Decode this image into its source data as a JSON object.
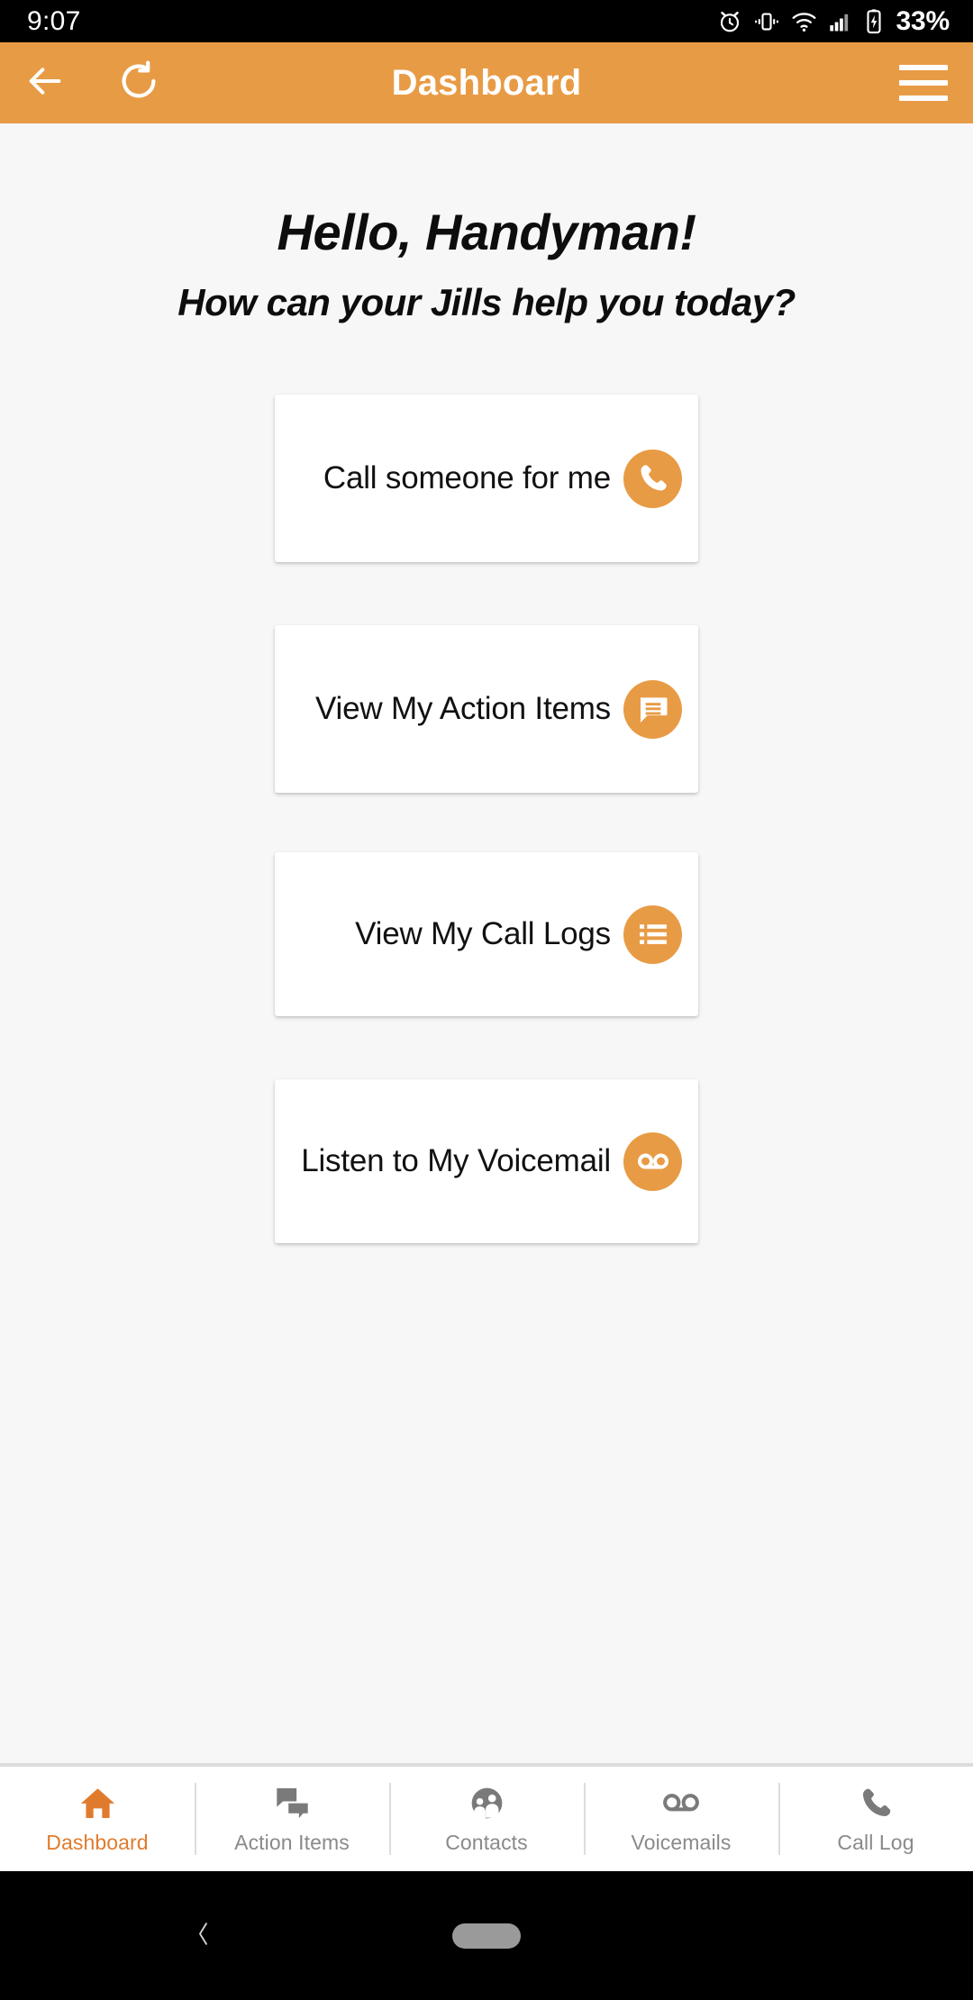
{
  "status_bar": {
    "time": "9:07",
    "battery_percent": "33%",
    "icons": [
      "alarm-icon",
      "vibrate-icon",
      "wifi-icon",
      "signal-icon",
      "battery-charging-icon"
    ]
  },
  "app_bar": {
    "title": "Dashboard",
    "back_icon": "arrow-back-icon",
    "refresh_icon": "refresh-icon",
    "menu_icon": "hamburger-menu-icon",
    "background_color": "#e89b45"
  },
  "greeting": {
    "line1": "Hello, Handyman!",
    "line2": "How can your Jills help you today?"
  },
  "cards": [
    {
      "label": "Call someone for me",
      "icon": "phone-icon"
    },
    {
      "label": "View My Action Items",
      "icon": "chat-bubble-icon"
    },
    {
      "label": "View My Call Logs",
      "icon": "list-icon"
    },
    {
      "label": "Listen to My Voicemail",
      "icon": "voicemail-icon"
    }
  ],
  "bottom_nav": {
    "active_color": "#e07b2e",
    "inactive_color": "#8a8a8a",
    "items": [
      {
        "label": "Dashboard",
        "icon": "home-icon",
        "active": true
      },
      {
        "label": "Action Items",
        "icon": "chats-icon",
        "active": false
      },
      {
        "label": "Contacts",
        "icon": "contacts-icon",
        "active": false
      },
      {
        "label": "Voicemails",
        "icon": "voicemail-icon",
        "active": false
      },
      {
        "label": "Call Log",
        "icon": "phone-icon",
        "active": false
      }
    ]
  },
  "system_nav": {
    "back_icon": "chevron-back-icon",
    "home_pill": "home-pill-handle"
  }
}
